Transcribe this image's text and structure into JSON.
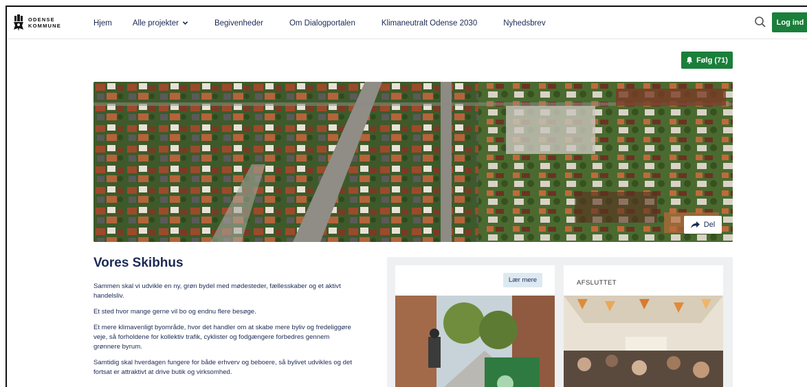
{
  "header": {
    "logo_line1": "ODENSE",
    "logo_line2": "KOMMUNE",
    "nav": [
      {
        "label": "Hjem"
      },
      {
        "label": "Alle projekter"
      },
      {
        "label": "Begivenheder"
      },
      {
        "label": "Om Dialogportalen"
      },
      {
        "label": "Klimaneutralt Odense 2030"
      },
      {
        "label": "Nyhedsbrev"
      }
    ],
    "login_label": "Log ind"
  },
  "follow": {
    "label": "Følg (71)"
  },
  "hero": {
    "share_label": "Del"
  },
  "content": {
    "title": "Vores Skibhus",
    "paragraphs": [
      "Sammen skal vi udvikle en ny, grøn bydel med mødesteder, fællesskaber og et aktivt handelsliv.",
      "Et sted hvor mange gerne vil bo og endnu flere besøge.",
      "Et mere klimavenligt byområde, hvor det handler om at skabe mere byliv og fredeliggøre veje, så forholdene for kollektiv trafik, cyklister og fodgængere forbedres gennem grønnere byrum.",
      "Samtidig skal hverdagen fungere for både erhverv og beboere, så bylivet udvikles og det fortsat er attraktivt at drive butik og virksomhed."
    ]
  },
  "cards": [
    {
      "button_label": "Lær mere"
    },
    {
      "status": "AFSLUTTET"
    }
  ],
  "colors": {
    "primary_green": "#1a7f3a",
    "navy_text": "#1b2a55",
    "card_bg": "#eef0f1"
  },
  "icons": [
    "logo-mark-icon",
    "chevron-down-icon",
    "search-icon",
    "bell-icon",
    "share-arrow-icon"
  ]
}
